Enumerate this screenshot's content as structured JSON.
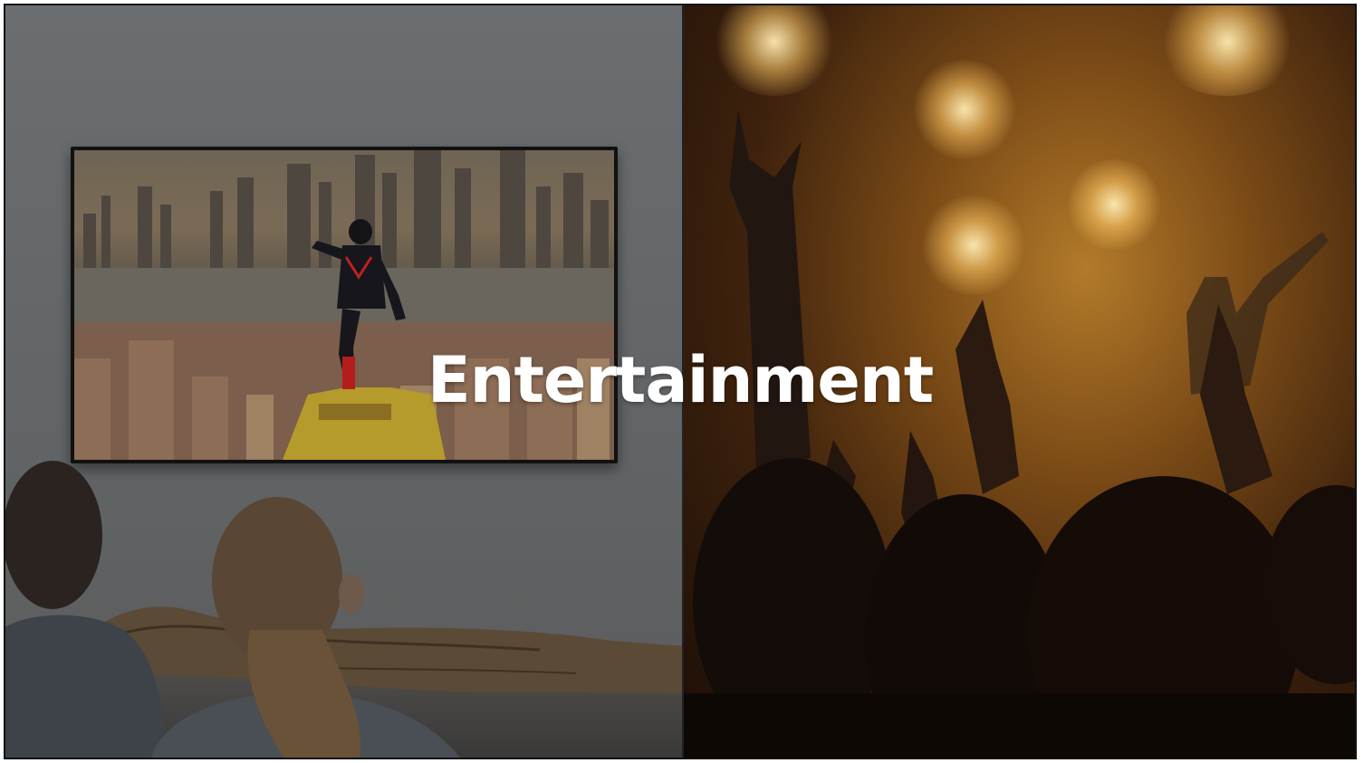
{
  "slide": {
    "title": "Entertainment"
  },
  "images": {
    "left": "living-room-tv-scene",
    "right": "concert-crowd-scene"
  },
  "colors": {
    "title_text": "#ffffff",
    "frame_border": "#111111"
  }
}
